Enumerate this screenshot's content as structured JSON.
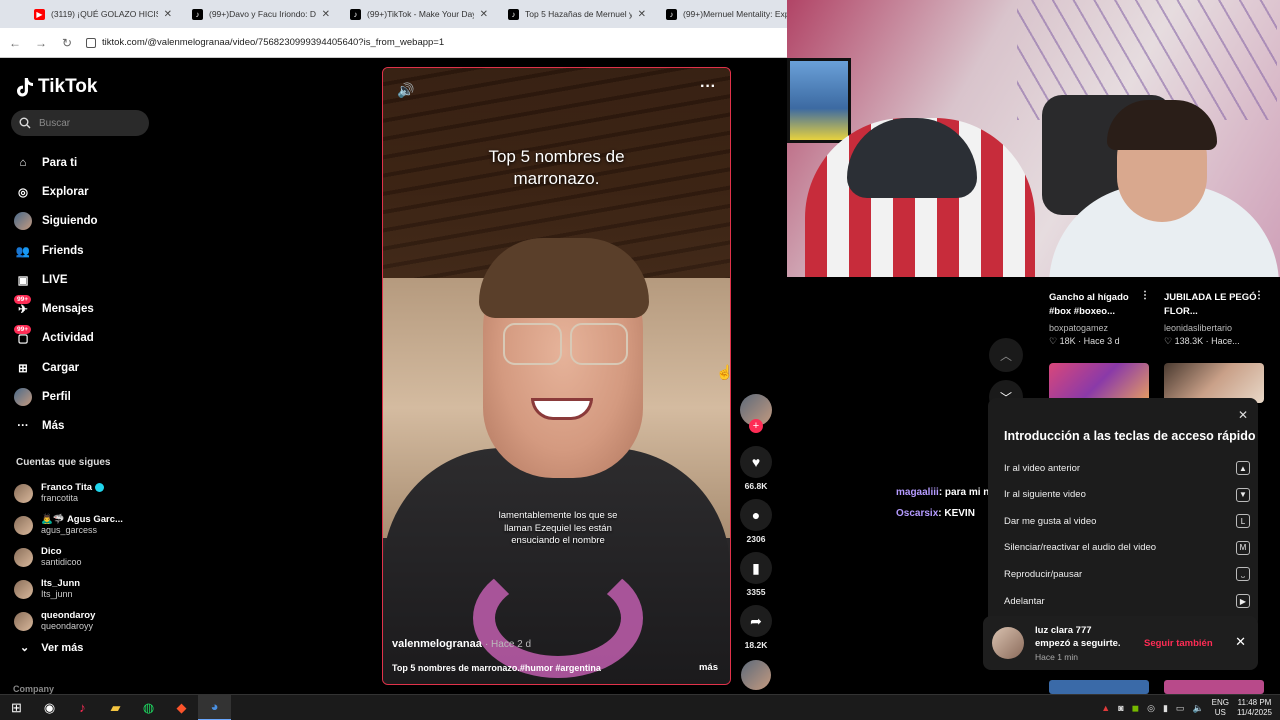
{
  "browser": {
    "tabs": [
      {
        "label": "(3119) ¡QUÉ GOLAZO HICISTE",
        "icon": "youtube-icon",
        "color": "#ff0000"
      },
      {
        "label": "(99+)Davo y Facu Iriondo: Dive",
        "icon": "tiktok-icon",
        "color": "#000000"
      },
      {
        "label": "(99+)TikTok - Make Your Day",
        "icon": "tiktok-icon",
        "color": "#000000"
      },
      {
        "label": "Top 5 Hazañas de Mernuel y Bo",
        "icon": "tiktok-icon",
        "color": "#000000"
      },
      {
        "label": "(99+)Mernuel Mentality: Explo",
        "icon": "tiktok-icon",
        "color": "#000000"
      }
    ],
    "url": "tiktok.com/@valenmelogranaa/video/7568230999394405640?is_from_webapp=1"
  },
  "sidebar": {
    "logo": "TikTok",
    "search_placeholder": "Buscar",
    "nav": [
      {
        "label": "Para ti",
        "icon": "home-icon",
        "glyph": "⌂"
      },
      {
        "label": "Explorar",
        "icon": "compass-icon",
        "glyph": "◎"
      },
      {
        "label": "Siguiendo",
        "icon": "following-avatar-icon",
        "glyph": "●"
      },
      {
        "label": "Friends",
        "icon": "friends-icon",
        "glyph": "👥"
      },
      {
        "label": "LIVE",
        "icon": "live-icon",
        "glyph": "▣"
      },
      {
        "label": "Mensajes",
        "icon": "messages-icon",
        "glyph": "✈",
        "badge": "99+"
      },
      {
        "label": "Actividad",
        "icon": "activity-icon",
        "glyph": "▢",
        "badge": "99+"
      },
      {
        "label": "Cargar",
        "icon": "upload-icon",
        "glyph": "⊞"
      },
      {
        "label": "Perfil",
        "icon": "profile-avatar-icon",
        "glyph": "●"
      },
      {
        "label": "Más",
        "icon": "more-icon",
        "glyph": "···"
      }
    ],
    "following_header": "Cuentas que sigues",
    "following": [
      {
        "name": "Franco Tita",
        "handle": "francotita",
        "verified": true
      },
      {
        "name": "🙇‍♂️🦈 Agus Garc...",
        "handle": "agus_garcess",
        "verified": false
      },
      {
        "name": "Dico",
        "handle": "santidicoo",
        "verified": false
      },
      {
        "name": "Its_Junn",
        "handle": "Its_junn",
        "verified": false
      },
      {
        "name": "queondaroy",
        "handle": "queondaroyy",
        "verified": false
      }
    ],
    "see_more": "Ver más",
    "company": "Company"
  },
  "video": {
    "title_line1": "Top 5 nombres de",
    "title_line2": "marronazo.",
    "subtitle": "lamentablemente los que se llaman Ezequiel les están ensuciando el nombre",
    "username": "valenmelogranaa",
    "time": "· Hace 2 d",
    "description": "Top 5 nombres de marronazo.#humor #argentina",
    "more": "más"
  },
  "actions": {
    "likes": "66.8K",
    "comments": "2306",
    "saves": "3355",
    "shares": "18.2K"
  },
  "recommendations": [
    {
      "title": "Gancho al hígado #box #boxeo...",
      "user": "boxpatogamez",
      "likes": "18K",
      "time": "· Hace 3 d"
    },
    {
      "title": "JUBILADA LE PEGÓ FLOR...",
      "user": "leonidaslibertario",
      "likes": "138.3K",
      "time": "· Hace..."
    }
  ],
  "chat": [
    {
      "user": "magaaliii",
      "text": ": para mi no"
    },
    {
      "user": "Oscarsix",
      "text": ": KEVIN"
    }
  ],
  "shortcuts": {
    "title": "Introducción a las teclas de acceso rápido",
    "items": [
      {
        "label": "Ir al video anterior",
        "key": "▲"
      },
      {
        "label": "Ir al siguiente video",
        "key": "▼"
      },
      {
        "label": "Dar me gusta al video",
        "key": "L"
      },
      {
        "label": "Silenciar/reactivar el audio del video",
        "key": "M"
      },
      {
        "label": "Reproducir/pausar",
        "key": "⎵"
      },
      {
        "label": "Adelantar",
        "key": "▶"
      }
    ]
  },
  "notification": {
    "user": "luz clara 777",
    "text": "empezó a seguirte.",
    "time": "Hace 1 min",
    "button": "Seguir también"
  },
  "taskbar": {
    "lang": "ENG",
    "region": "US",
    "time": "11:48 PM",
    "date": "11/4/2025"
  }
}
